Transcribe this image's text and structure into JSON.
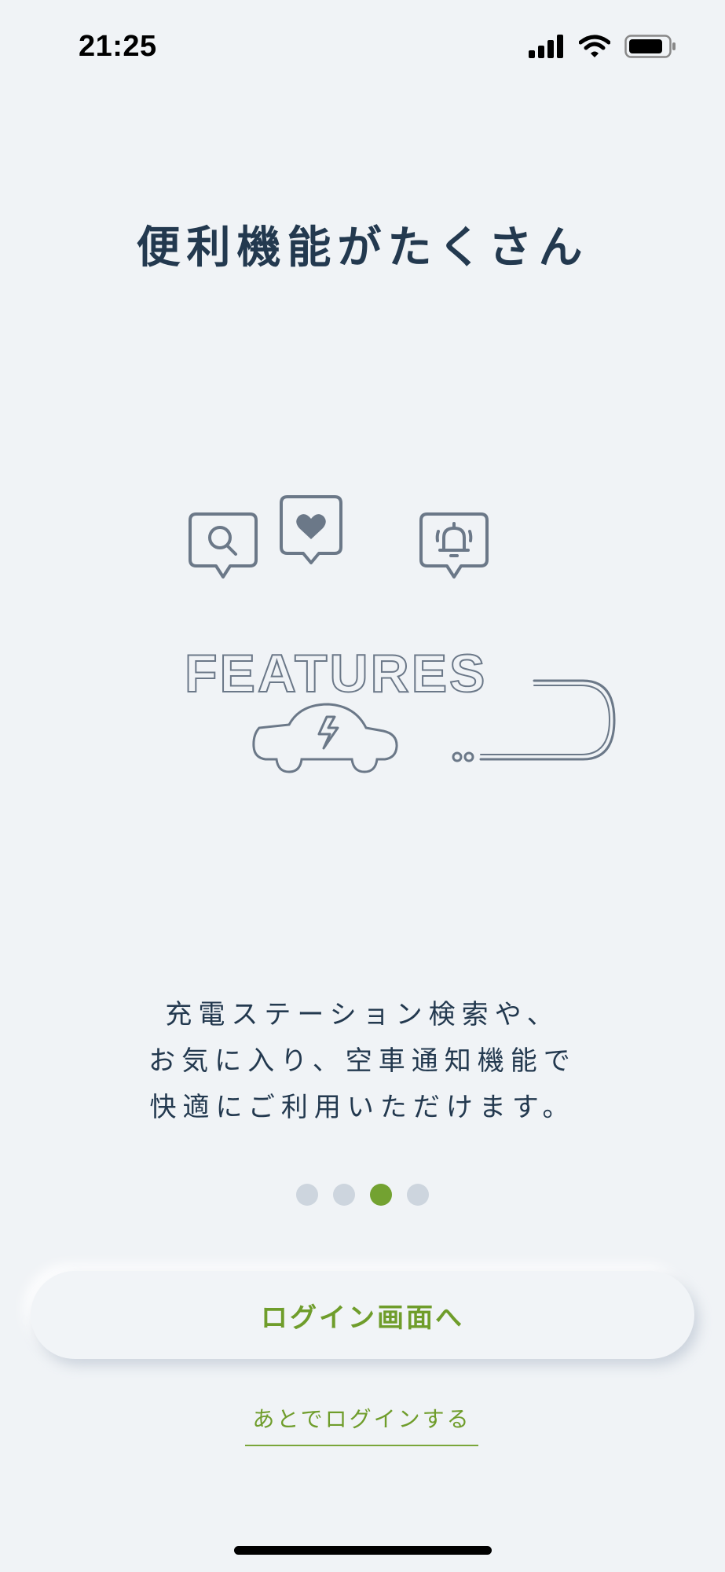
{
  "status_bar": {
    "time": "21:25",
    "icons": [
      "signal-icon",
      "wifi-icon",
      "battery-icon"
    ]
  },
  "onboarding": {
    "title": "便利機能がたくさん",
    "illustration": {
      "word": "FEATURES",
      "icons": [
        "search-icon",
        "heart-icon",
        "alarm-bell-icon",
        "ev-car-icon"
      ]
    },
    "description_lines": [
      "充電ステーション検索や、",
      "お気に入り、空車通知機能で",
      "快適にご利用いただけます。"
    ],
    "pager": {
      "total": 4,
      "current": 3
    },
    "login_button_label": "ログイン画面へ",
    "later_link_label": "あとでログインする"
  },
  "colors": {
    "background": "#f0f3f6",
    "text": "#23394f",
    "accent": "#73a231",
    "dot_inactive": "#cdd5de",
    "illustration_stroke": "#6b7888"
  }
}
